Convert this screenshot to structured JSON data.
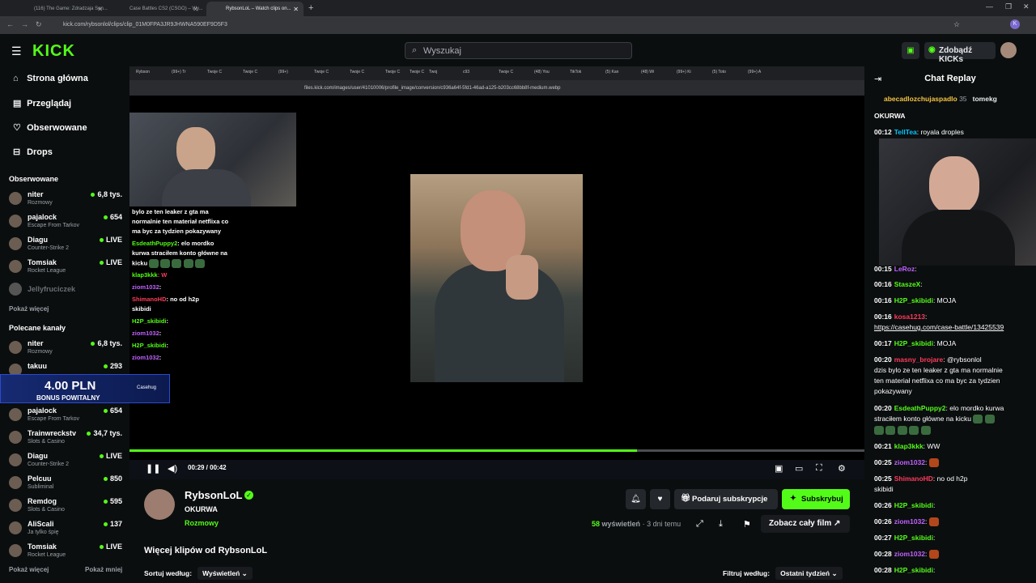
{
  "os_tabs": [
    {
      "label": "(116) The Game: Zdradzaja Sen..."
    },
    {
      "label": "Case Battles CS2 (CSGO) – Wy..."
    },
    {
      "label": "RybsonLoL – Watch clips on...",
      "active": true
    }
  ],
  "url": "kick.com/rybsonlol/clips/clip_01M0FPA3JR9JHWNA590EF9D5F3",
  "kick": {
    "logo": "KICK",
    "search_placeholder": "Wyszukaj",
    "get_kicks": "Zdobądź KICKs"
  },
  "nav": [
    {
      "label": "Strona główna",
      "icon": "home-icon"
    },
    {
      "label": "Przeglądaj",
      "icon": "browse-icon"
    },
    {
      "label": "Obserwowane",
      "icon": "heart-icon"
    },
    {
      "label": "Drops",
      "icon": "drops-icon"
    }
  ],
  "followed_title": "Obserwowane",
  "followed": [
    {
      "name": "niter",
      "sub": "Rozmowy",
      "viewers": "6,8 tys."
    },
    {
      "name": "pajalock",
      "sub": "Escape From Tarkov",
      "viewers": "654"
    },
    {
      "name": "Diagu",
      "sub": "Counter-Strike 2",
      "viewers": "LIVE"
    },
    {
      "name": "Tomsiak",
      "sub": "Rocket League",
      "viewers": "LIVE"
    },
    {
      "name": "Jellyfruciczek",
      "sub": "",
      "viewers": ""
    }
  ],
  "show_more": "Pokaż więcej",
  "recommended_title": "Polecane kanały",
  "recommended": [
    {
      "name": "niter",
      "sub": "Rozmowy",
      "viewers": "6,8 tys."
    },
    {
      "name": "takuu",
      "sub": "",
      "viewers": "293"
    },
    {
      "name": "pajalock",
      "sub": "Escape From Tarkov",
      "viewers": "654"
    },
    {
      "name": "Trainwreckstv",
      "sub": "Slots & Casino",
      "viewers": "34,7 tys."
    },
    {
      "name": "Diagu",
      "sub": "Counter-Strike 2",
      "viewers": "LIVE"
    },
    {
      "name": "Pelcuu",
      "sub": "Subliminal",
      "viewers": "850"
    },
    {
      "name": "Remdog",
      "sub": "Slots & Casino",
      "viewers": "595"
    },
    {
      "name": "AliScali",
      "sub": "Ja tylko śpię",
      "viewers": "137"
    },
    {
      "name": "Tomsiak",
      "sub": "Rocket League",
      "viewers": "LIVE"
    }
  ],
  "show_more_2": "Pokaż więcej",
  "show_less": "Pokaż mniej",
  "inner_url": "files.kick.com/images/user/41010006/profile_image/conversion/c936a64f-5fd1-46ad-a125-b203cc68bb8f-medium.webp",
  "inner_tabs": [
    "Rybson",
    "(99+) Tr",
    "Twoje C",
    "Twoje C",
    "(99+)",
    "Twoje C",
    "Twoje C",
    "Twoje C",
    "Twoje C",
    "Twoj",
    "c93",
    "Twoje C",
    "(48) You",
    "TikTok",
    "(5) Kan",
    "(48) Wi",
    "(99+) Ki",
    "(5) Toto",
    "(99+) A"
  ],
  "overlay_chat": [
    {
      "user": "",
      "text": "bylo ze ten leaker z gta ma",
      "color": ""
    },
    {
      "user": "",
      "text": "normalnie ten materiał netflixa co",
      "color": ""
    },
    {
      "user": "",
      "text": "ma byc za tydzien pokazywany",
      "color": ""
    },
    {
      "user": "EsdeathPuppy2",
      "text": ": elo mordko",
      "color": "g"
    },
    {
      "user": "",
      "text": "kurwa straciłem konto główne na",
      "color": ""
    },
    {
      "user": "",
      "text": "kicku",
      "color": ""
    },
    {
      "user": "klap3kkk",
      "text": ": W",
      "color": "g"
    },
    {
      "user": "ziom1032",
      "text": ":",
      "color": "p"
    },
    {
      "user": "ShimanoHD",
      "text": ": no od h2p",
      "color": "r"
    },
    {
      "user": "",
      "text": "skibidi",
      "color": ""
    },
    {
      "user": "H2P_skibidi",
      "text": ":",
      "color": "g"
    },
    {
      "user": "ziom1032",
      "text": ":",
      "color": "p"
    },
    {
      "user": "H2P_skibidi",
      "text": ":",
      "color": "g"
    },
    {
      "user": "ziom1032",
      "text": ":",
      "color": "p"
    }
  ],
  "promo": {
    "amount": "4.00 PLN",
    "text": "BONUS POWITALNY",
    "brand": "Casehug"
  },
  "player": {
    "time": "00:29 / 00:42",
    "progress": 0.69
  },
  "channel": {
    "name": "RybsonLoL",
    "title": "OKURWA",
    "category": "Rozmowy",
    "gift": "Podaruj subskrypcje",
    "subscribe": "Subskrybuj",
    "views_count": "58",
    "views_label": "wyświetleń",
    "age": "· 3 dni temu",
    "full_video": "Zobacz cały film"
  },
  "more_clips": "Więcej klipów od RybsonLoL",
  "sort_label": "Sortuj według:",
  "sort_value": "Wyświetleń",
  "filter_label": "Filtruj według:",
  "filter_value": "Ostatni tydzień",
  "chat": {
    "title": "Chat Replay",
    "pinned_user": "abecadlozchujaspadlo",
    "pinned_count": "35",
    "pinned_user2": "tomekg",
    "first_msg": "OKURWA",
    "messages": [
      {
        "ts": "00:12",
        "user": "TellTea",
        "color": "b",
        "text": ": royala droples"
      },
      {
        "ts": "00:15",
        "user": "LeRoz",
        "color": "p",
        "text": ":"
      },
      {
        "ts": "00:16",
        "user": "StaszeX",
        "color": "g",
        "text": ":"
      },
      {
        "ts": "00:16",
        "user": "H2P_skibidi",
        "color": "g",
        "text": ": MOJA"
      },
      {
        "ts": "00:16",
        "user": "kosa1213",
        "color": "r",
        "text": ":"
      },
      {
        "ts": "",
        "user": "",
        "color": "",
        "text": "https://casehug.com/case-battle/13425539"
      },
      {
        "ts": "00:17",
        "user": "H2P_skibidi",
        "color": "g",
        "text": ": MOJA"
      },
      {
        "ts": "00:20",
        "user": "masny_brojare",
        "color": "r",
        "text": ": @rybsonlol"
      },
      {
        "ts": "",
        "user": "",
        "color": "",
        "text": "dzis bylo ze ten leaker z gta ma normalnie"
      },
      {
        "ts": "",
        "user": "",
        "color": "",
        "text": "ten materiał netflixa co ma byc za tydzien"
      },
      {
        "ts": "",
        "user": "",
        "color": "",
        "text": "pokazywany"
      },
      {
        "ts": "00:20",
        "user": "EsdeathPuppy2",
        "color": "g",
        "text": ": elo mordko kurwa"
      },
      {
        "ts": "",
        "user": "",
        "color": "",
        "text": "straciłem konto główne na kicku"
      },
      {
        "ts": "00:21",
        "user": "klap3kkk",
        "color": "g",
        "text": ": WW"
      },
      {
        "ts": "00:25",
        "user": "ziom1032",
        "color": "p",
        "text": ":"
      },
      {
        "ts": "00:25",
        "user": "ShimanoHD",
        "color": "r",
        "text": ": no od h2p"
      },
      {
        "ts": "",
        "user": "",
        "color": "",
        "text": "skibidi"
      },
      {
        "ts": "00:26",
        "user": "H2P_skibidi",
        "color": "g",
        "text": ":"
      },
      {
        "ts": "00:26",
        "user": "ziom1032",
        "color": "p",
        "text": ":"
      },
      {
        "ts": "00:27",
        "user": "H2P_skibidi",
        "color": "g",
        "text": ":"
      },
      {
        "ts": "00:28",
        "user": "ziom1032",
        "color": "p",
        "text": ":"
      },
      {
        "ts": "00:28",
        "user": "H2P_skibidi",
        "color": "g",
        "text": ":"
      }
    ]
  }
}
